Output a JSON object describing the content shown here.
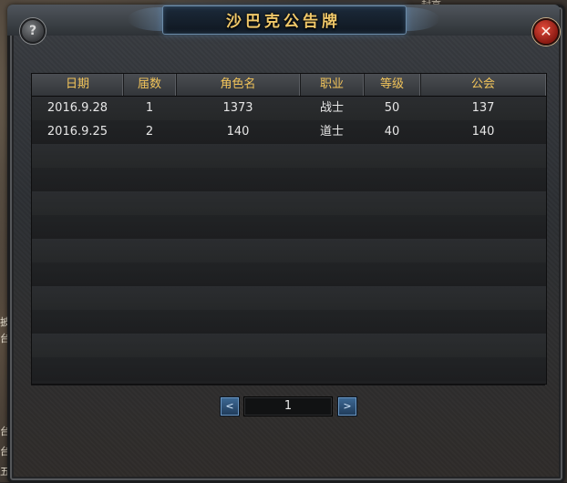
{
  "window": {
    "title": "沙巴克公告牌",
    "help_label": "?",
    "close_label": "✕"
  },
  "background": {
    "top_text": "封高",
    "left_texts": [
      "披",
      "台",
      "台",
      "台",
      "五"
    ]
  },
  "table": {
    "headers": [
      "日期",
      "届数",
      "角色名",
      "职业",
      "等级",
      "公会"
    ],
    "rows": [
      [
        "2016.9.28",
        "1",
        "1373",
        "战士",
        "50",
        "137"
      ],
      [
        "2016.9.25",
        "2",
        "140",
        "道士",
        "40",
        "140"
      ]
    ]
  },
  "pagination": {
    "prev_icon": "chevron-left-icon",
    "next_icon": "chevron-right-icon",
    "prev_label": "<",
    "next_label": ">",
    "current_page": "1"
  },
  "colors": {
    "header_text": "#f2c45a",
    "title_text": "#f0c86a",
    "cell_text": "#e6e6e6",
    "close_button": "#c8301f",
    "pager_button": "#2f5680"
  }
}
